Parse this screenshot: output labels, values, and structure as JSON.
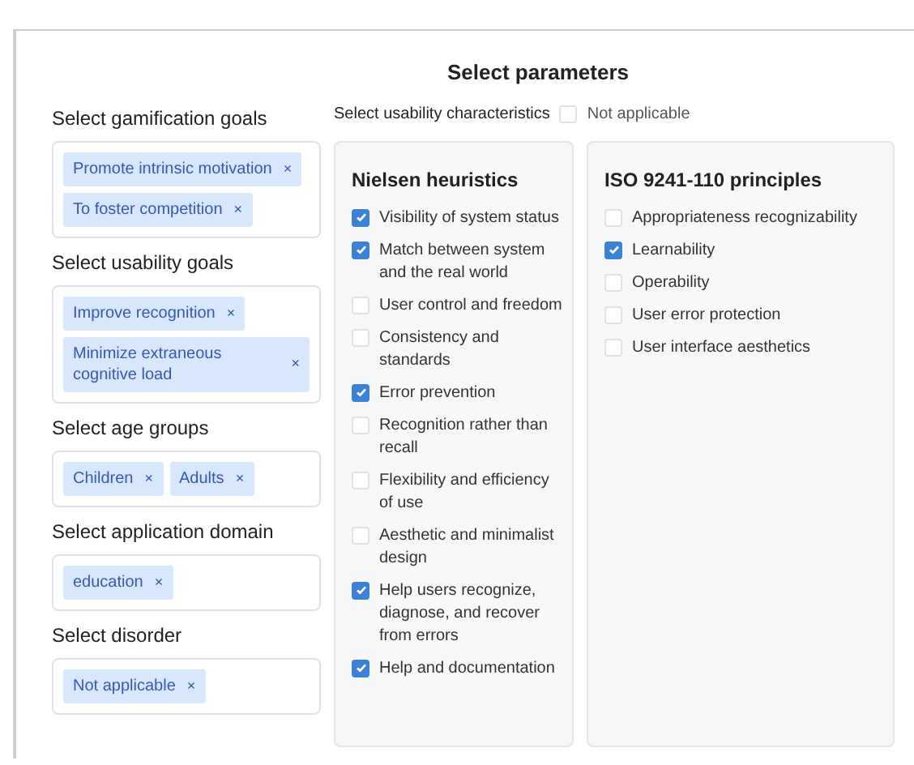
{
  "title": "Select parameters",
  "selects": [
    {
      "label": "Select gamification goals",
      "chips": [
        {
          "label": "Promote intrinsic motivation",
          "remove": "×"
        },
        {
          "label": "To foster competition",
          "remove": "×"
        }
      ]
    },
    {
      "label": "Select usability goals",
      "chips": [
        {
          "label": "Improve recognition",
          "remove": "×"
        },
        {
          "label": "Minimize extraneous cognitive load",
          "remove": "×"
        }
      ]
    },
    {
      "label": "Select age groups",
      "chips": [
        {
          "label": "Children",
          "remove": "×"
        },
        {
          "label": "Adults",
          "remove": "×"
        }
      ]
    },
    {
      "label": "Select application domain",
      "chips": [
        {
          "label": "education",
          "remove": "×"
        }
      ]
    },
    {
      "label": "Select disorder",
      "chips": [
        {
          "label": "Not applicable",
          "remove": "×"
        }
      ]
    }
  ],
  "usability": {
    "label": "Select usability characteristics",
    "not_applicable": {
      "label": "Not applicable",
      "checked": false
    },
    "groups": [
      {
        "title": "Nielsen heuristics",
        "items": [
          {
            "label": "Visibility of system status",
            "checked": true
          },
          {
            "label": "Match between system and the real world",
            "checked": true
          },
          {
            "label": "User control and freedom",
            "checked": false
          },
          {
            "label": "Consistency and standards",
            "checked": false
          },
          {
            "label": "Error prevention",
            "checked": true
          },
          {
            "label": "Recognition rather than recall",
            "checked": false
          },
          {
            "label": "Flexibility and efficiency of use",
            "checked": false
          },
          {
            "label": "Aesthetic and minimalist design",
            "checked": false
          },
          {
            "label": "Help users recognize, diagnose, and recover from errors",
            "checked": true
          },
          {
            "label": "Help and documentation",
            "checked": true
          }
        ]
      },
      {
        "title": "ISO 9241-110 principles",
        "items": [
          {
            "label": "Appropriateness recognizability",
            "checked": false
          },
          {
            "label": "Learnability",
            "checked": true
          },
          {
            "label": "Operability",
            "checked": false
          },
          {
            "label": "User error protection",
            "checked": false
          },
          {
            "label": "User interface aesthetics",
            "checked": false
          }
        ]
      }
    ]
  }
}
